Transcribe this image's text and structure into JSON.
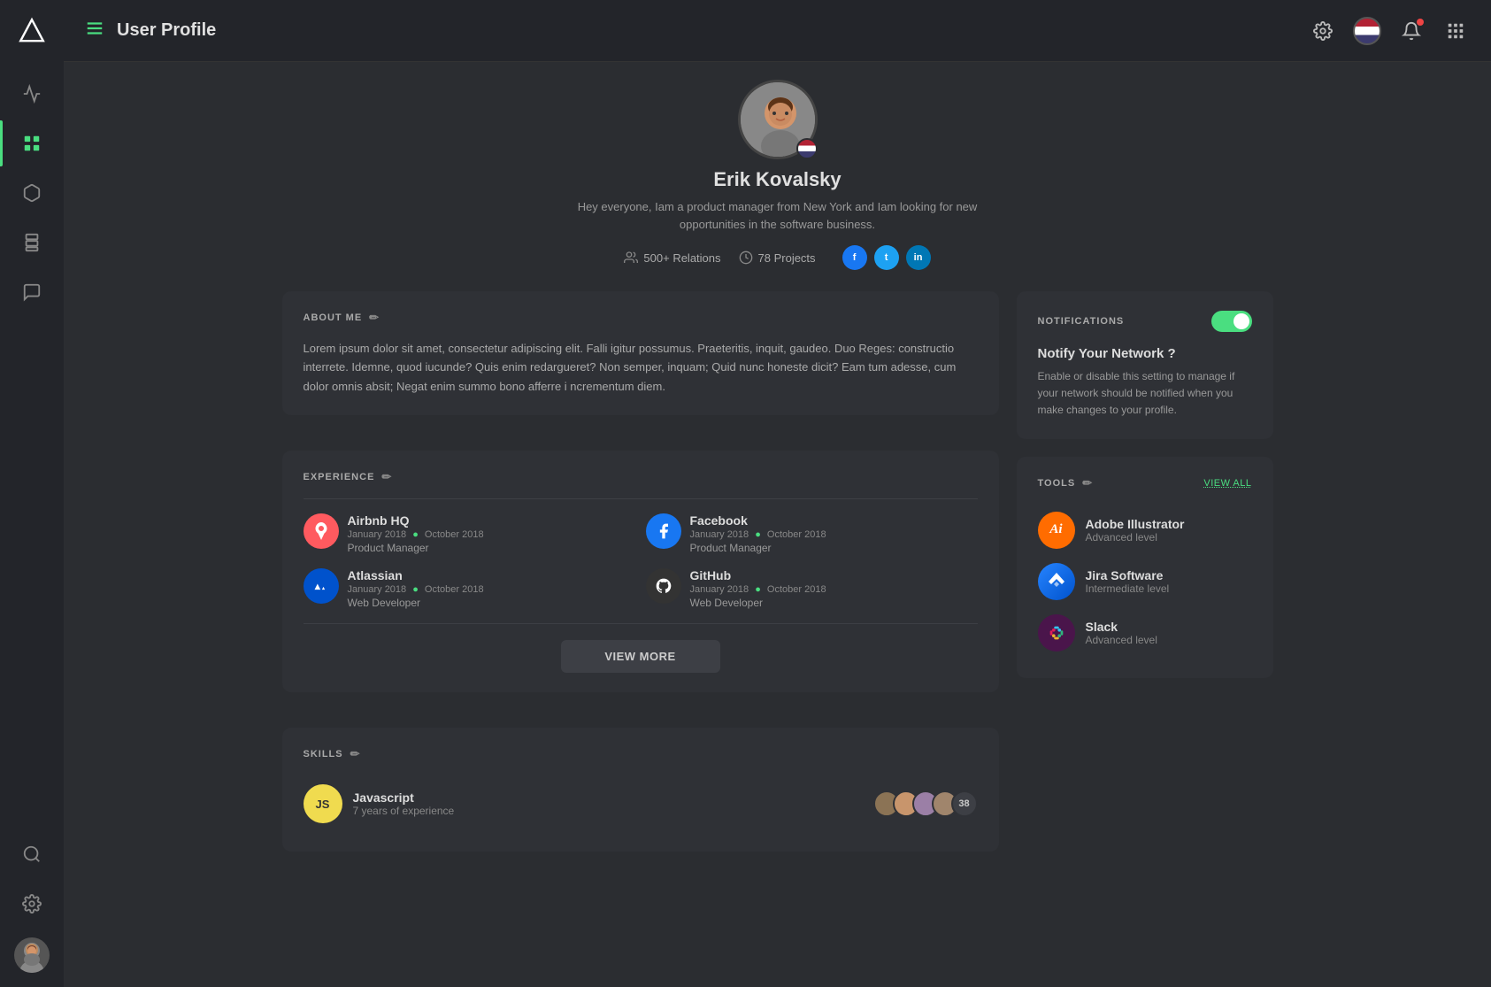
{
  "sidebar": {
    "logo_alt": "Logo",
    "items": [
      {
        "id": "activity",
        "label": "Activity",
        "active": false
      },
      {
        "id": "dashboard",
        "label": "Dashboard",
        "active": true
      },
      {
        "id": "3d",
        "label": "3D Objects",
        "active": false
      },
      {
        "id": "components",
        "label": "Components",
        "active": false
      },
      {
        "id": "messages",
        "label": "Messages",
        "active": false
      },
      {
        "id": "search",
        "label": "Search",
        "active": false
      },
      {
        "id": "settings",
        "label": "Settings",
        "active": false
      }
    ]
  },
  "header": {
    "title": "User Profile",
    "icons": {
      "menu": "menu-icon",
      "settings": "settings-icon",
      "flag": "flag-icon",
      "bell": "bell-icon",
      "grid": "grid-icon"
    }
  },
  "profile": {
    "name": "Erik Kovalsky",
    "bio": "Hey everyone,  Iam a product manager from New York and Iam looking for new opportunities in the software business.",
    "relations": "500+ Relations",
    "projects": "78 Projects",
    "socials": [
      "f",
      "t",
      "in"
    ]
  },
  "about_me": {
    "section_title": "ABOUT ME",
    "text": "Lorem ipsum dolor sit amet, consectetur adipiscing elit. Falli igitur possumus. Praeteritis, inquit, gaudeo. Duo Reges: constructio interrete. Idemne, quod iucunde? Quis enim redargueret? Non semper, inquam; Quid nunc honeste dicit? Eam tum adesse, cum dolor omnis absit; Negat enim summo bono afferre i ncrementum diem."
  },
  "experience": {
    "section_title": "EXPERIENCE",
    "items": [
      {
        "company": "Airbnb HQ",
        "date_start": "January 2018",
        "date_end": "October 2018",
        "role": "Product Manager",
        "logo_color": "#ff5a5f",
        "logo_letter": "A"
      },
      {
        "company": "Facebook",
        "date_start": "January 2018",
        "date_end": "October 2018",
        "role": "Product Manager",
        "logo_color": "#1877f2",
        "logo_letter": "f"
      },
      {
        "company": "Atlassian",
        "date_start": "January 2018",
        "date_end": "October 2018",
        "role": "Web Developer",
        "logo_color": "#0052cc",
        "logo_letter": "A"
      },
      {
        "company": "GitHub",
        "date_start": "January 2018",
        "date_end": "October 2018",
        "role": "Web Developer",
        "logo_color": "#333",
        "logo_letter": "G"
      }
    ],
    "view_more_label": "VIEW MORE"
  },
  "skills": {
    "section_title": "SKILLS",
    "items": [
      {
        "name": "Javascript",
        "experience": "7 years of experience",
        "badge_bg": "#f0db4f",
        "badge_text": "#333",
        "badge_label": "JS",
        "avatar_count": 38
      }
    ]
  },
  "notifications": {
    "section_title": "NOTIFICATIONS",
    "toggle_on": true,
    "network_title": "Notify Your Network ?",
    "description": "Enable or disable this setting to manage if your network should be notified when you make changes to your profile."
  },
  "tools": {
    "section_title": "TOOLS",
    "view_all_label": "VIEW ALL",
    "items": [
      {
        "name": "Adobe Illustrator",
        "level": "Advanced level",
        "logo_bg": "#ff6c00",
        "logo_text": "Ai",
        "logo_text_color": "#fff"
      },
      {
        "name": "Jira Software",
        "level": "Intermediate level",
        "logo_bg": "#0052cc",
        "logo_text": "◇",
        "logo_text_color": "#fff"
      },
      {
        "name": "Slack",
        "level": "Advanced level",
        "logo_bg": "#4a154b",
        "logo_text": "#",
        "logo_text_color": "#e01e5a"
      }
    ]
  }
}
